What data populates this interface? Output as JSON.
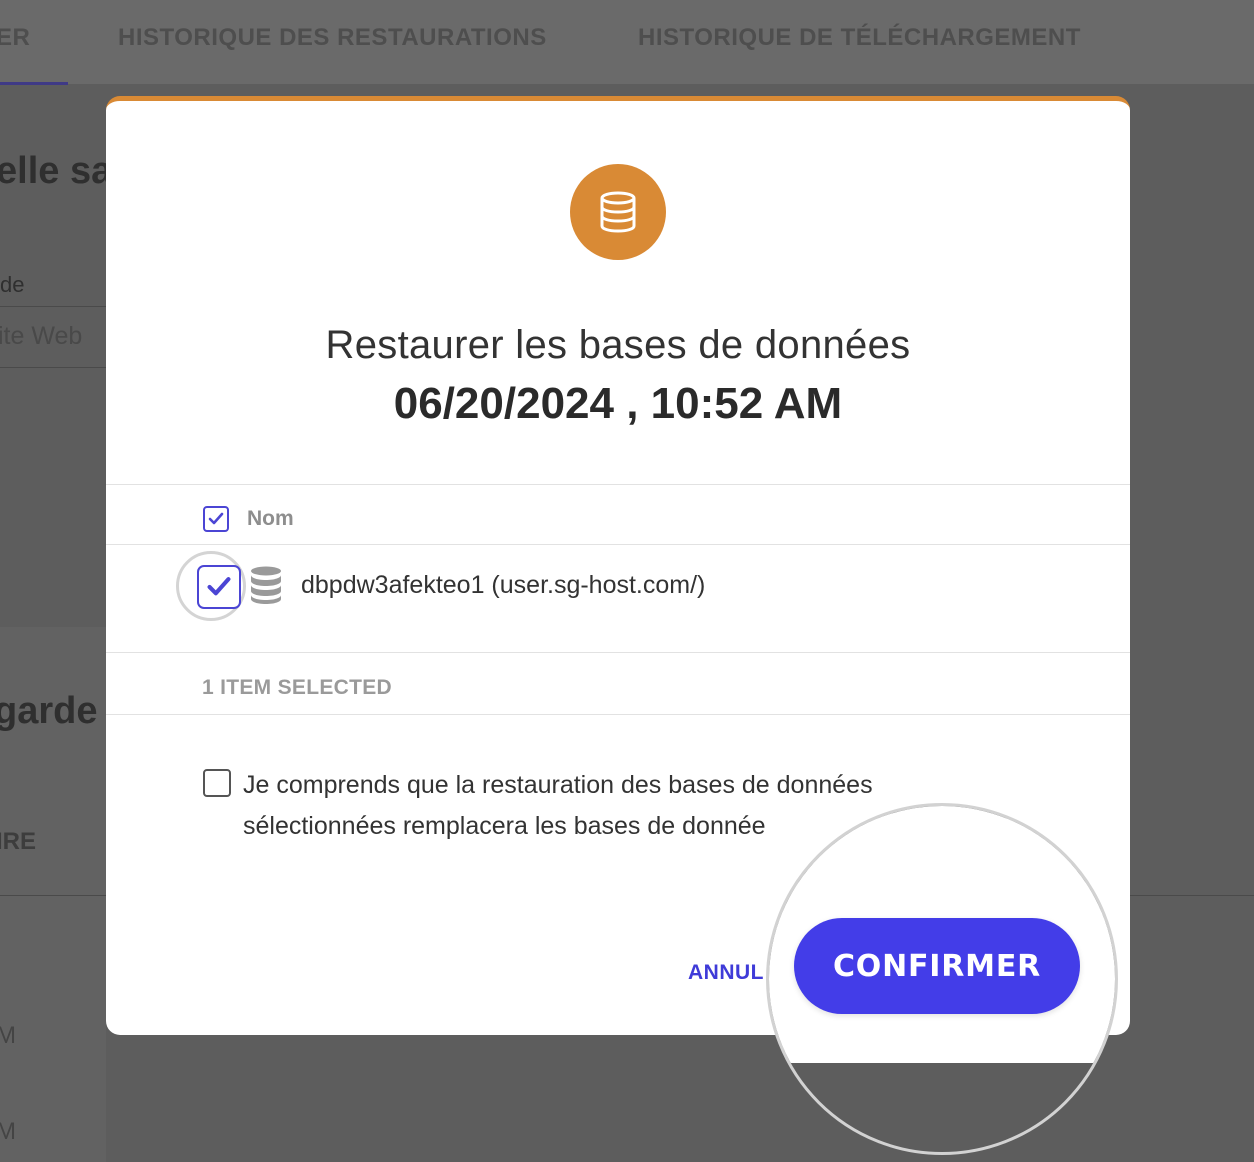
{
  "background": {
    "tabs": [
      {
        "label": "ER"
      },
      {
        "label": "HISTORIQUE DES RESTAURATIONS"
      },
      {
        "label": "HISTORIQUE DE TÉLÉCHARGEMENT"
      }
    ],
    "heading_1": "elle sa",
    "field_label": "de",
    "field_value": "ite Web",
    "heading_2": "garde",
    "col_header": "IRE",
    "row_times": [
      "M",
      "M"
    ]
  },
  "modal": {
    "title": "Restaurer les bases de données",
    "datetime": "06/20/2024 , 10:52 AM",
    "table": {
      "header": "Nom",
      "rows": [
        {
          "label": "dbpdw3afekteo1 (user.sg-host.com/)",
          "checked": true
        }
      ]
    },
    "selected_count": "1 ITEM SELECTED",
    "consent_text": "Je comprends que la restauration des bases de données sélectionnées remplacera les bases de donnée",
    "consent_checked": false,
    "cancel_label": "ANNUL",
    "confirm_label": "CONFIRMER"
  },
  "colors": {
    "accent": "#d98a35",
    "primary": "#433de8",
    "overlay": "#5d5d5d"
  },
  "icons": {
    "badge": "database-icon",
    "row": "database-icon",
    "check": "checkmark-icon"
  }
}
